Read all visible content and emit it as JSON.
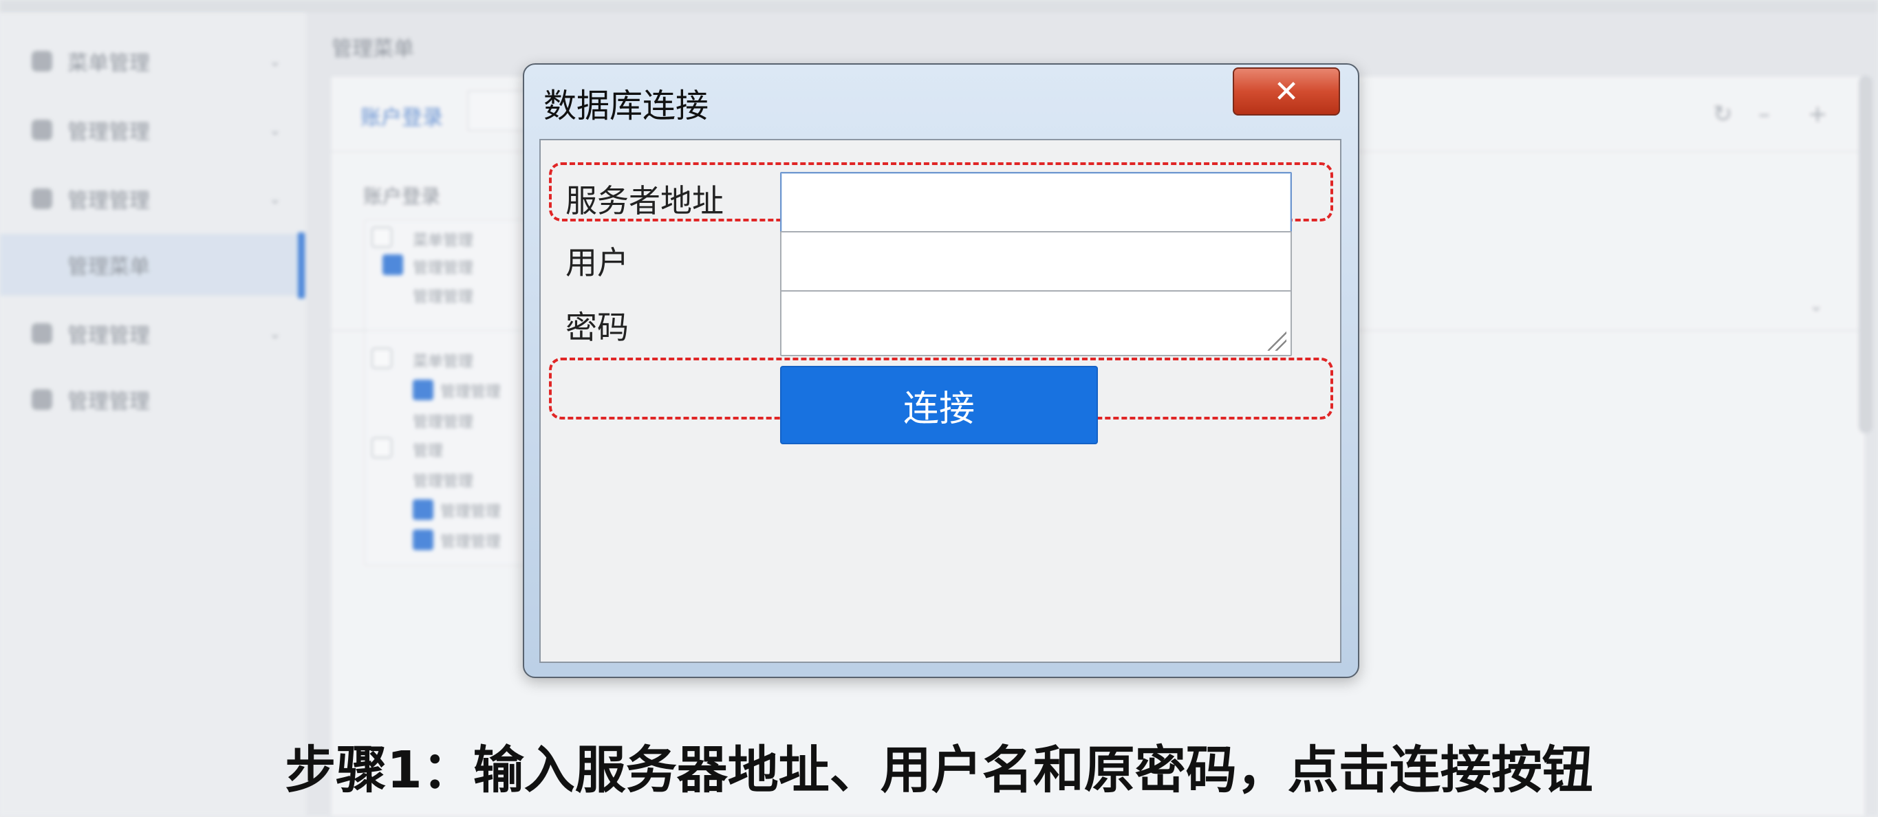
{
  "background": {
    "sidebar_items": [
      "菜单管理",
      "管理管理",
      "管理管理",
      "管理菜单",
      "管理管理",
      "管理管理"
    ],
    "header_title": "管理菜单",
    "tab_label": "账户登录",
    "section_label": "账户登录",
    "tree_rows": [
      "菜单管理",
      "管理管理",
      "管理管理",
      "菜单管理",
      "管理管理",
      "管理管理",
      "管理",
      "管理管理",
      "管理管理",
      "管理管理"
    ]
  },
  "dialog": {
    "title": "数据库连接",
    "close_label": "✕",
    "server_label": "服务者地址",
    "server_value": "",
    "user_label": "用户",
    "user_value": "",
    "password_label": "密码",
    "password_value": "",
    "connect_label": "连接"
  },
  "caption": "步骤1：输入服务器地址、用户名和原密码，点击连接按钮",
  "colors": {
    "accent": "#1872e0",
    "highlight": "#e02626",
    "close": "#d24c2f"
  }
}
